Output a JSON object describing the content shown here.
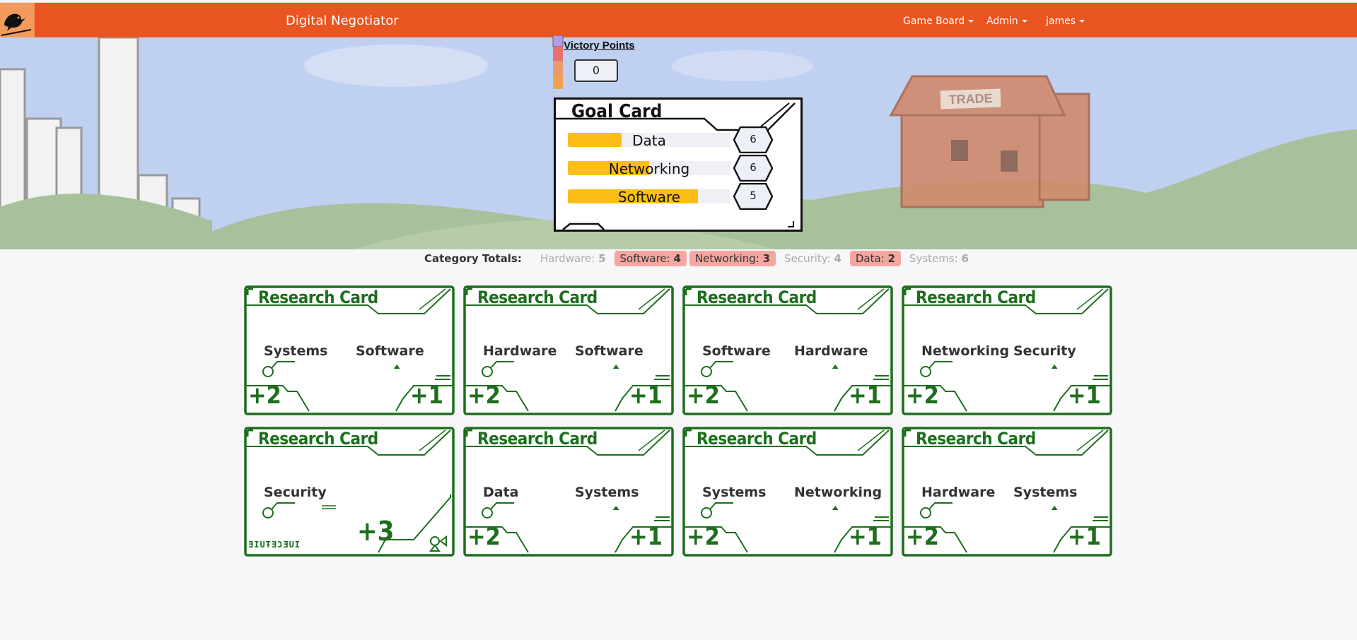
{
  "navbar": {
    "brand": "Digital Negotiator",
    "menus": [
      "Game Board",
      "Admin",
      "james"
    ]
  },
  "hero": {
    "trade_sign": "TRADE"
  },
  "victory_points": {
    "title": "Victory Points",
    "value": "0"
  },
  "goal_card": {
    "title": "Goal Card",
    "rows": [
      {
        "label": "Data",
        "target": "6",
        "progress": 0.33
      },
      {
        "label": "Networking",
        "target": "6",
        "progress": 0.5
      },
      {
        "label": "Software",
        "target": "5",
        "progress": 0.8
      }
    ]
  },
  "category_totals": {
    "label": "Category Totals:",
    "items": [
      {
        "name": "Hardware:",
        "value": "5",
        "highlight": false
      },
      {
        "name": "Software:",
        "value": "4",
        "highlight": true
      },
      {
        "name": "Networking:",
        "value": "3",
        "highlight": true
      },
      {
        "name": "Security:",
        "value": "4",
        "highlight": false
      },
      {
        "name": "Data:",
        "value": "2",
        "highlight": true
      },
      {
        "name": "Systems:",
        "value": "6",
        "highlight": false
      }
    ]
  },
  "research_cards": [
    {
      "title": "Research Card",
      "cat1": "Systems",
      "cat2": "Software",
      "left_bonus": "+2",
      "right_bonus": "+1"
    },
    {
      "title": "Research Card",
      "cat1": "Hardware",
      "cat2": "Software",
      "left_bonus": "+2",
      "right_bonus": "+1"
    },
    {
      "title": "Research Card",
      "cat1": "Software",
      "cat2": "Hardware",
      "left_bonus": "+2",
      "right_bonus": "+1"
    },
    {
      "title": "Research Card",
      "cat1": "Networking",
      "cat2": "Security",
      "left_bonus": "+2",
      "right_bonus": "+1"
    },
    {
      "title": "Research Card",
      "cat1": "Security",
      "cat2": "",
      "big_bonus": "+3",
      "code": "ƎIUŦƎƆƎUI",
      "special": true
    },
    {
      "title": "Research Card",
      "cat1": "Data",
      "cat2": "Systems",
      "left_bonus": "+2",
      "right_bonus": "+1"
    },
    {
      "title": "Research Card",
      "cat1": "Systems",
      "cat2": "Networking",
      "left_bonus": "+2",
      "right_bonus": "+1"
    },
    {
      "title": "Research Card",
      "cat1": "Hardware",
      "cat2": "Systems",
      "left_bonus": "+2",
      "right_bonus": "+1"
    }
  ],
  "colors": {
    "navbar": "#e95420",
    "card_green": "#1e6e1e",
    "goal_fill": "#fdbd17",
    "highlight_pill": "#f5a6a0"
  }
}
